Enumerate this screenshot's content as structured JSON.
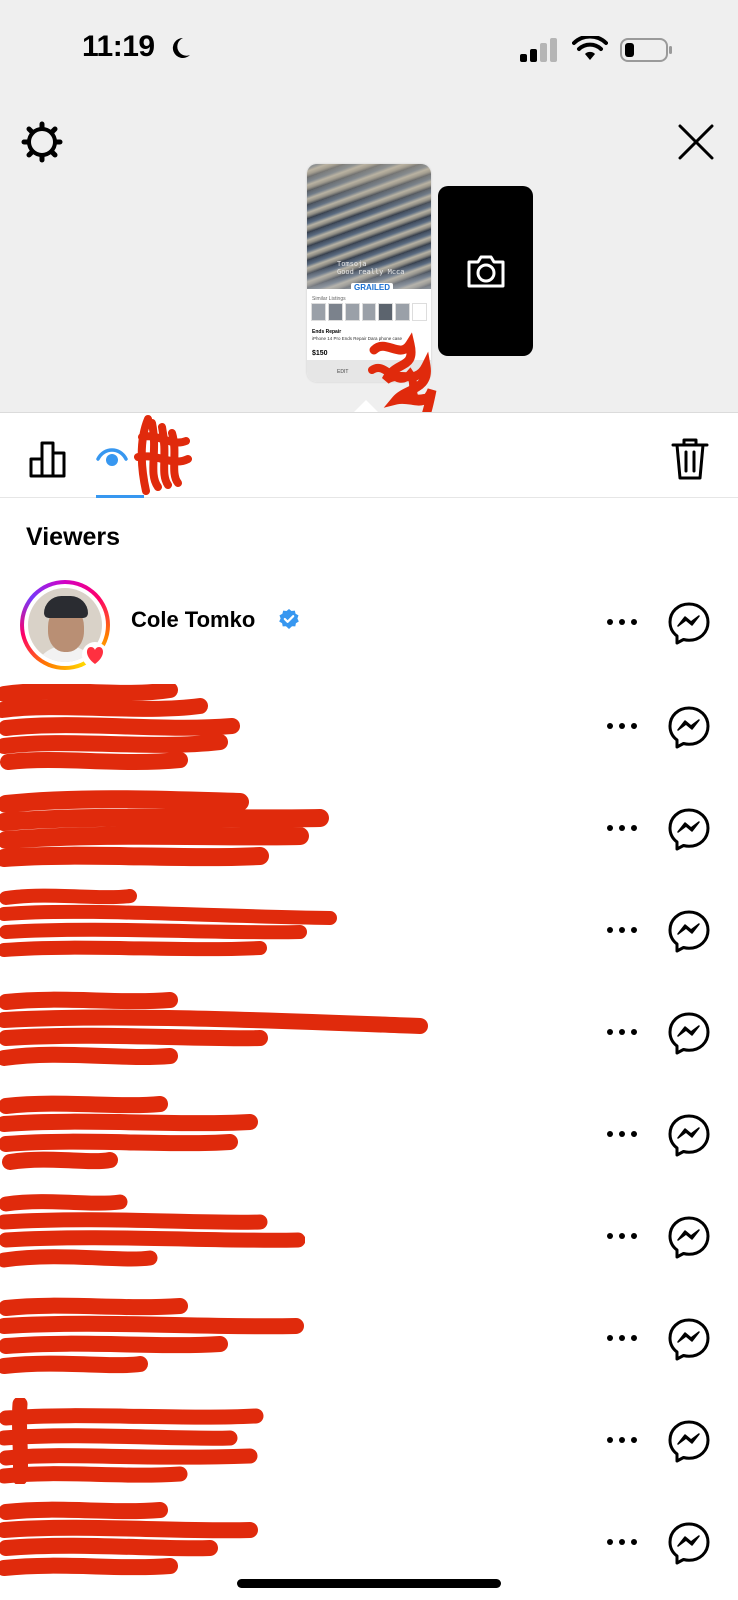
{
  "status_bar": {
    "time": "11:19"
  },
  "story_preview": {
    "caption": "Tomsoja\nGood really Mcca",
    "brand": "GRAILED",
    "similar_label": "Similar Listings",
    "seller": "Ends Repair",
    "item_title": "iPhone 14 Pro Ends Repair Dara phone case",
    "price": "$150",
    "edit_label": "EDIT"
  },
  "section": {
    "title": "Viewers"
  },
  "viewers": [
    {
      "name": "Cole Tomko",
      "verified": true,
      "liked": true
    },
    {
      "name": "",
      "redacted": true
    },
    {
      "name": "",
      "redacted": true
    },
    {
      "name": "",
      "redacted": true
    },
    {
      "name": "",
      "redacted": true
    },
    {
      "name": "",
      "redacted": true
    },
    {
      "name": "",
      "redacted": true
    },
    {
      "name": "",
      "redacted": true
    },
    {
      "name": "",
      "redacted": true
    },
    {
      "name": "",
      "redacted": true
    }
  ],
  "icons": {
    "settings": "gear-icon",
    "close": "close-icon",
    "camera": "camera-icon",
    "insights": "bar-chart-icon",
    "views": "eye-icon",
    "delete": "trash-icon",
    "more": "more-horizontal-icon",
    "message": "messenger-icon"
  },
  "colors": {
    "accent": "#3797f0",
    "redaction": "#e02a0c",
    "like": "#ff3040"
  }
}
